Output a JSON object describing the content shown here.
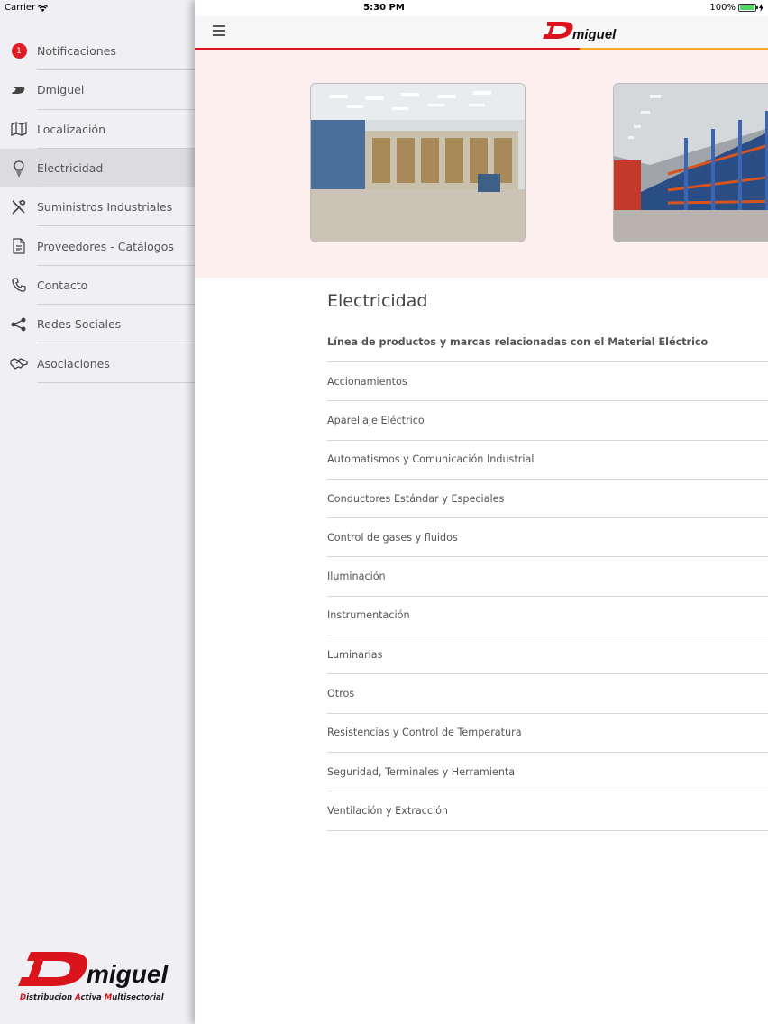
{
  "status_bar": {
    "carrier": "Carrier",
    "time": "5:30 PM",
    "battery": "100%"
  },
  "colors": {
    "brand_red": "#d9141c",
    "accent_yellow": "#f0b030",
    "banner_bg": "#fdefee",
    "sidebar_bg": "#f0eff4"
  },
  "sidebar": {
    "items": [
      {
        "label": "Notificaciones",
        "icon": "notification-badge-icon",
        "badge": "1"
      },
      {
        "label": "Dmiguel",
        "icon": "dmiguel-logo-icon"
      },
      {
        "label": "Localización",
        "icon": "map-icon"
      },
      {
        "label": "Electricidad",
        "icon": "bulb-icon",
        "active": true
      },
      {
        "label": "Suministros Industriales",
        "icon": "tools-icon"
      },
      {
        "label": "Proveedores - Catálogos",
        "icon": "document-icon"
      },
      {
        "label": "Contacto",
        "icon": "phone-icon"
      },
      {
        "label": "Redes Sociales",
        "icon": "share-icon"
      },
      {
        "label": "Asociaciones",
        "icon": "handshake-icon"
      }
    ],
    "logo": {
      "brand_letter": "D",
      "brand_rest": "miguel",
      "tagline_parts": [
        "D",
        "istribucion ",
        "A",
        "ctiva ",
        "M",
        "ultisectorial"
      ]
    }
  },
  "header": {
    "brand_letter": "D",
    "brand_rest": "miguel"
  },
  "content": {
    "title": "Electricidad",
    "subtitle": "Línea de productos y marcas relacionadas con el Material Eléctrico",
    "items": [
      "Accionamientos",
      "Aparellaje Eléctrico",
      "Automatismos y Comunicación Industrial",
      "Conductores Estándar y Especiales",
      "Control de gases y fluidos",
      "Iluminación",
      "Instrumentación",
      "Luminarias",
      "Otros",
      "Resistencias y Control de Temperatura",
      "Seguridad, Terminales y Herramienta",
      "Ventilación y Extracción"
    ]
  }
}
